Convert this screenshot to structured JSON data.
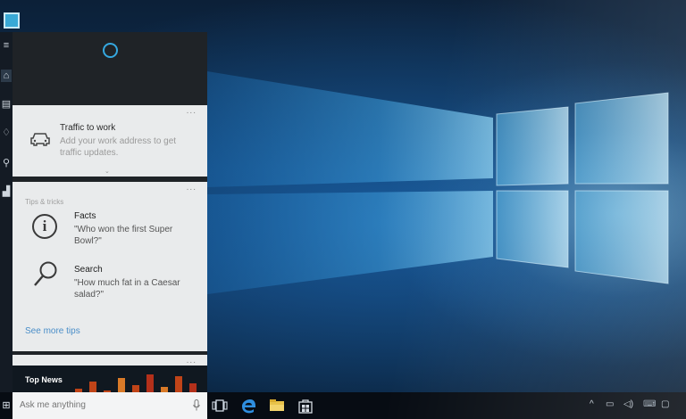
{
  "colors": {
    "accent": "#35a8e0",
    "panel": "#1f2327",
    "card": "#e9ebec",
    "link": "#4a8ec8",
    "taskbar": "#070c13"
  },
  "rail": {
    "icons": [
      "hamburger-menu-icon",
      "home-icon",
      "notebook-icon",
      "lightbulb-icon",
      "feedback-icon",
      "settings-icon"
    ],
    "glyphs": {
      "menu": "≡",
      "home": "⌂",
      "notebook": "▤",
      "tips": "♢",
      "feedback": "⚲",
      "more": "▟"
    }
  },
  "traffic_card": {
    "title": "Traffic to work",
    "subtitle": "Add your work address to get traffic updates.",
    "more": "...",
    "chevron": "⌄",
    "icon": "car-icon"
  },
  "tips_card": {
    "heading": "Tips & tricks",
    "more": "...",
    "facts": {
      "title": "Facts",
      "example": "\"Who won the first Super Bowl?\"",
      "icon": "info-icon",
      "glyph": "i"
    },
    "search": {
      "title": "Search",
      "example": "\"How much fat in a Caesar salad?\"",
      "icon": "magnifier-icon"
    },
    "see_more": "See more tips"
  },
  "news_card": {
    "label": "Top News",
    "more": "..."
  },
  "search_box": {
    "placeholder": "Ask me anything",
    "icon": "microphone-icon"
  },
  "taskbar": {
    "start_glyph": "⊞",
    "apps": [
      "task-view-icon",
      "edge-icon",
      "file-explorer-icon",
      "store-icon"
    ],
    "tray": {
      "chevron": "^",
      "battery": "▭",
      "volume": "◁)",
      "notifications": "▢"
    }
  }
}
